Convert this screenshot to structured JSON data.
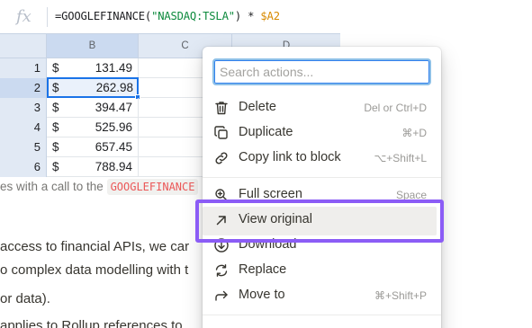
{
  "sheet": {
    "fx_symbol": "fx",
    "formula_prefix": "=GOOGLEFINANCE(",
    "formula_string": "\"NASDAQ:TSLA\"",
    "formula_middle": ") * ",
    "formula_ref": "$A2",
    "columns": [
      "B",
      "C",
      "D"
    ],
    "rows": [
      {
        "num": "1",
        "currency": "$",
        "value": "131.49"
      },
      {
        "num": "2",
        "currency": "$",
        "value": "262.98"
      },
      {
        "num": "3",
        "currency": "$",
        "value": "394.47"
      },
      {
        "num": "4",
        "currency": "$",
        "value": "525.96"
      },
      {
        "num": "5",
        "currency": "$",
        "value": "657.45"
      },
      {
        "num": "6",
        "currency": "$",
        "value": "788.94"
      }
    ]
  },
  "doc": {
    "caption_text": "es with a call to the ",
    "caption_code": "GOOGLEFINANCE",
    "line1": "access to financial APIs, we car",
    "line2": "o complex data modelling with t",
    "line3": "or data).",
    "line4": "applies to Rollup references to"
  },
  "menu": {
    "search_placeholder": "Search actions...",
    "items": [
      {
        "label": "Delete",
        "shortcut": "Del or Ctrl+D",
        "icon": "trash-icon"
      },
      {
        "label": "Duplicate",
        "shortcut": "⌘+D",
        "icon": "duplicate-icon"
      },
      {
        "label": "Copy link to block",
        "shortcut": "⌥+Shift+L",
        "icon": "link-icon"
      },
      {
        "label": "Full screen",
        "shortcut": "Space",
        "icon": "full-screen-icon"
      },
      {
        "label": "View original",
        "shortcut": "",
        "icon": "arrow-up-right-icon"
      },
      {
        "label": "Download",
        "shortcut": "",
        "icon": "download-icon"
      },
      {
        "label": "Replace",
        "shortcut": "",
        "icon": "replace-icon"
      },
      {
        "label": "Move to",
        "shortcut": "⌘+Shift+P",
        "icon": "move-to-icon"
      }
    ]
  },
  "colors": {
    "highlight_border": "#8b5cf6",
    "selection_blue": "#1a73e8",
    "header_fill": "#e1e9f4"
  }
}
